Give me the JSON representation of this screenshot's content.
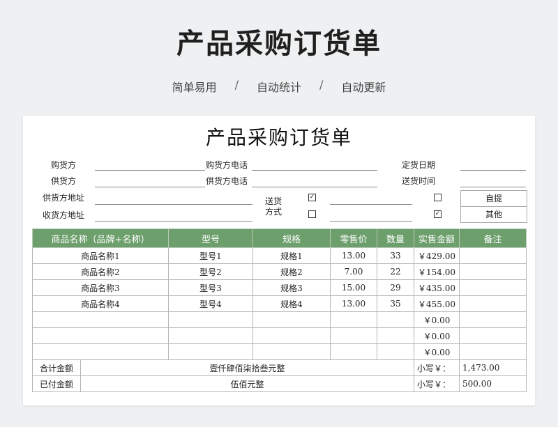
{
  "header": {
    "title": "产品采购订货单",
    "features": [
      "简单易用",
      "自动统计",
      "自动更新"
    ],
    "separator": "/"
  },
  "form": {
    "title": "产品采购订货单",
    "buyer_label": "购货方",
    "buyer_phone_label": "购货方电话",
    "order_date_label": "定货日期",
    "supplier_label": "供货方",
    "supplier_phone_label": "供货方电话",
    "delivery_time_label": "送货时间",
    "supplier_address_label": "供货方地址",
    "receiver_address_label": "收货方地址",
    "delivery_method_label_1": "送货",
    "delivery_method_label_2": "方式",
    "pickup_label": "自提",
    "other_label": "其他",
    "check_mark": "✓",
    "delivery_checked": true,
    "other_checked": true
  },
  "table": {
    "columns": [
      "商品名称（品牌+名称）",
      "型号",
      "规格",
      "零售价",
      "数量",
      "实售金额",
      "备注"
    ],
    "rows": [
      [
        "商品名称1",
        "型号1",
        "规格1",
        "13.00",
        "33",
        "￥429.00",
        ""
      ],
      [
        "商品名称2",
        "型号2",
        "规格2",
        "7.00",
        "22",
        "￥154.00",
        ""
      ],
      [
        "商品名称3",
        "型号3",
        "规格3",
        "15.00",
        "29",
        "￥435.00",
        ""
      ],
      [
        "商品名称4",
        "型号4",
        "规格4",
        "13.00",
        "35",
        "￥455.00",
        ""
      ],
      [
        "",
        "",
        "",
        "",
        "",
        "￥0.00",
        ""
      ],
      [
        "",
        "",
        "",
        "",
        "",
        "￥0.00",
        ""
      ],
      [
        "",
        "",
        "",
        "",
        "",
        "￥0.00",
        ""
      ]
    ],
    "total_label": "合计金额",
    "total_words": "壹仟肆佰柒拾叁元整",
    "total_small_label": "小写￥：",
    "total_amount": "1,473.00",
    "paid_label": "已付金额",
    "paid_words": "伍佰元整",
    "paid_small_label": "小写￥：",
    "paid_amount": "500.00"
  }
}
